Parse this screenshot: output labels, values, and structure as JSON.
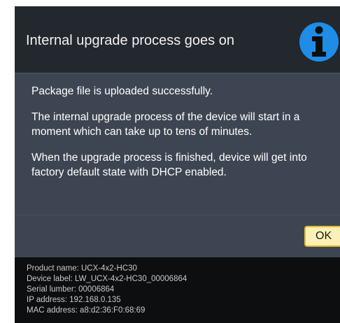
{
  "dialog": {
    "title": "Internal upgrade process goes on",
    "icon": "info-icon",
    "icon_color": "#1f8ce6",
    "paragraphs": [
      "Package file is uploaded successfully.",
      "The internal upgrade process of the device will start in a",
      "moment which can take up to tens of minutes.",
      "When the upgrade process is finished, device will get into",
      "factory default state with DHCP enabled."
    ],
    "ok_label": "OK",
    "ok_color": "#fbf0b6"
  },
  "device_info": {
    "product_name": "Product name: UCX-4x2-HC30",
    "device_label": "Device label: LW_UCX-4x2-HC30_00006864",
    "serial_number": "Serial lumber: 00006864",
    "ip_address": "IP address: 192.168.0.135",
    "mac_address": "MAC address: a8:d2:36:F0:68:69"
  }
}
